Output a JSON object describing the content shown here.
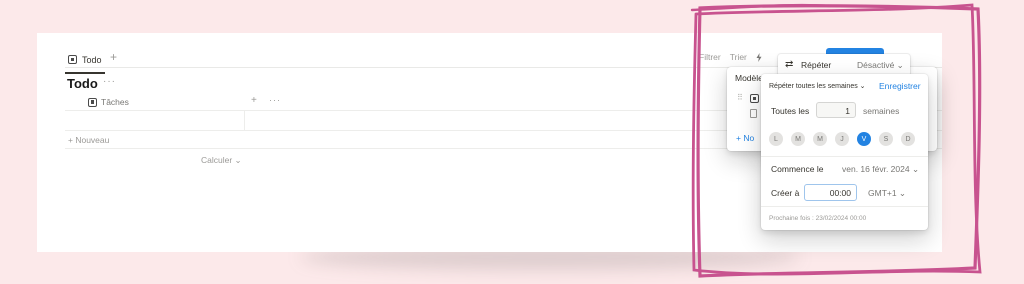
{
  "colors": {
    "background": "#fce9ea",
    "accent": "#2383e2",
    "highlight": "#c8538f"
  },
  "header": {
    "view_tab": "Todo",
    "add_view": "+",
    "toolbar": {
      "filter": "Filtrer",
      "sort": "Trier"
    }
  },
  "database": {
    "title": "Todo",
    "more": "···",
    "column": "Tâches",
    "column_add": "+",
    "column_more": "···",
    "add_row": "+ Nouveau",
    "calculate": "Calculer ⌄"
  },
  "templates": {
    "title": "Modèle",
    "new_label": "+ No"
  },
  "repeat": {
    "icon": "⇄",
    "label": "Répéter",
    "status": "Désactivé ⌄"
  },
  "repeat_panel": {
    "frequency": "Répéter toutes les semaines ⌄",
    "save": "Enregistrer",
    "every_label": "Toutes les",
    "every_value": "1",
    "every_unit": "semaines",
    "days": [
      {
        "label": "L",
        "selected": false
      },
      {
        "label": "M",
        "selected": false
      },
      {
        "label": "M",
        "selected": false
      },
      {
        "label": "J",
        "selected": false
      },
      {
        "label": "V",
        "selected": true
      },
      {
        "label": "S",
        "selected": false
      },
      {
        "label": "D",
        "selected": false
      }
    ],
    "start_label": "Commence le",
    "start_value": "ven. 16 févr. 2024 ⌄",
    "create_label": "Créer à",
    "time_value": "00:00",
    "timezone": "GMT+1 ⌄",
    "next_run": "Prochaine fois : 23/02/2024 00:00"
  }
}
